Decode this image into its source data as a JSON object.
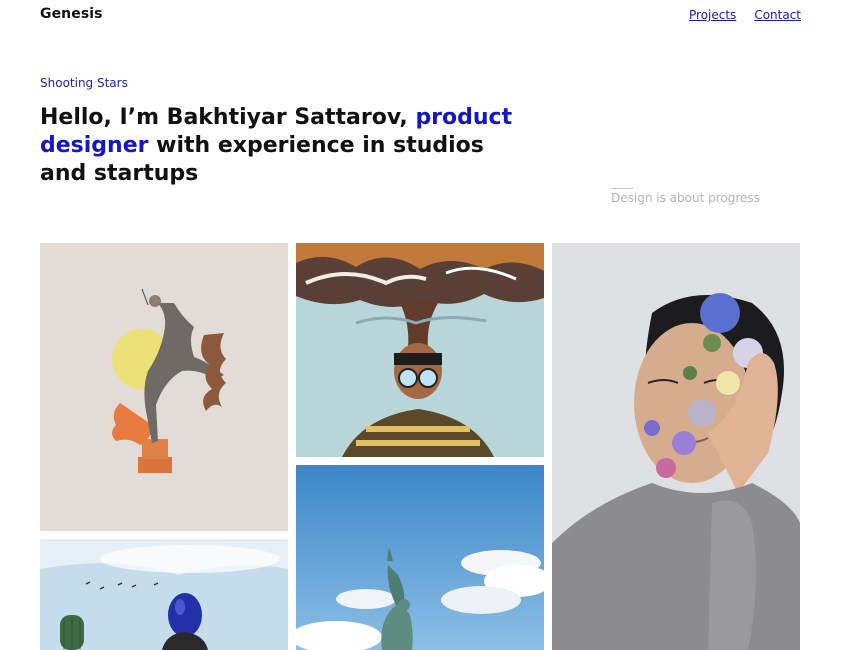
{
  "header": {
    "brand": "Genesis",
    "nav": [
      {
        "label": "Projects"
      },
      {
        "label": "Contact"
      }
    ]
  },
  "hero": {
    "eyebrow": "Shooting Stars",
    "title_part1": "Hello, I’m Bakhtiyar Sattarov, ",
    "title_accent": "product designer",
    "title_part2": " with experience in studios and startups",
    "tagline": "Design is about progress"
  },
  "colors": {
    "accent": "#1515c9",
    "text": "#111111",
    "muted": "#b4b4b4",
    "link": "#1a1aa8"
  },
  "gallery": [
    {
      "subject": "dancer-collage",
      "alt": ""
    },
    {
      "subject": "smoke-head-portrait",
      "alt": ""
    },
    {
      "subject": "flower-face-portrait",
      "alt": ""
    },
    {
      "subject": "blue-balloon",
      "alt": ""
    },
    {
      "subject": "statue-of-liberty",
      "alt": ""
    }
  ]
}
